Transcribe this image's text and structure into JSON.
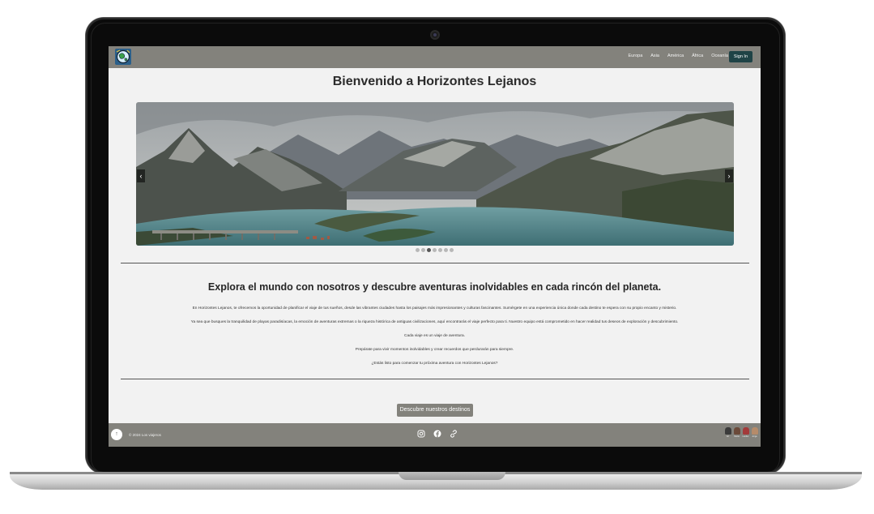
{
  "nav": {
    "links": [
      "Europa",
      "Asia",
      "América",
      "África",
      "Oceanía"
    ],
    "signin_label": "Sign In"
  },
  "hero": {
    "title": "Bienvenido a Horizontes Lejanos",
    "prev_icon": "‹",
    "next_icon": "›",
    "slide_count": 7,
    "active_slide": 3
  },
  "intro": {
    "heading": "Explora el mundo con nosotros y descubre aventuras inolvidables en cada rincón del planeta.",
    "paragraphs": [
      "En Horizontes Lejanos, te ofrecemos la oportunidad de planificar el viaje de tus sueños, desde las vibrantes ciudades hasta los paisajes más impresionantes y culturas fascinantes. Sumérgete en una experiencia única donde cada destino te espera con su propio encanto y misterio.",
      "Ya sea que busques la tranquilidad de playas paradisíacas, la emoción de aventuras extremas o la riqueza histórica de antiguas civilizaciones, aquí encontrarás el viaje perfecto para ti. Nuestro equipo está comprometido en hacer realidad tus deseos de exploración y descubrimiento.",
      "Cada viaje es un viaje de aventura.",
      "Prepárate para vivir momentos inolvidables y crear recuerdos que perdurarán para siempre.",
      "¿Estás listo para comenzar tu próxima aventura con Horizontes Lejanos?"
    ],
    "cta_label": "Descubre nuestros destinos"
  },
  "footer": {
    "up_icon": "↑",
    "copyright": "© 2024 Los viajeros",
    "social_icons": [
      "instagram-icon",
      "facebook-icon",
      "link-icon"
    ],
    "team": [
      {
        "name": "Ari",
        "color": "#3b3b3b"
      },
      {
        "name": "Maria",
        "color": "#6b4a3a"
      },
      {
        "name": "Lander",
        "color": "#a33a3a"
      },
      {
        "name": "Jorge",
        "color": "#b58b6a"
      }
    ]
  }
}
